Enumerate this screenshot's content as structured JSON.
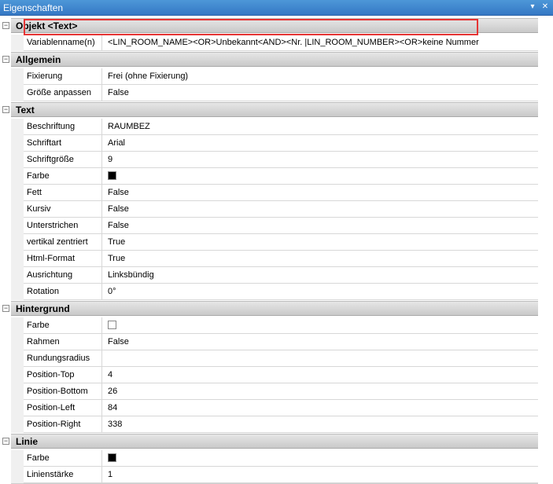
{
  "window": {
    "title": "Eigenschaften",
    "dropdown_glyph": "▾",
    "close_glyph": "✕"
  },
  "categories": [
    {
      "label": "Objekt <Text>",
      "rows": [
        {
          "name": "Variablenname(n)",
          "value": "<LIN_ROOM_NAME><OR>Unbekannt<AND><Nr. |LIN_ROOM_NUMBER><OR>keine Nummer"
        }
      ]
    },
    {
      "label": "Allgemein",
      "rows": [
        {
          "name": "Fixierung",
          "value": "Frei (ohne Fixierung)"
        },
        {
          "name": "Größe anpassen",
          "value": "False"
        }
      ]
    },
    {
      "label": "Text",
      "rows": [
        {
          "name": "Beschriftung",
          "value": "RAUMBEZ"
        },
        {
          "name": "Schriftart",
          "value": "Arial"
        },
        {
          "name": "Schriftgröße",
          "value": "9"
        },
        {
          "name": "Farbe",
          "value": "",
          "swatch": "#000000"
        },
        {
          "name": "Fett",
          "value": "False"
        },
        {
          "name": "Kursiv",
          "value": "False"
        },
        {
          "name": "Unterstrichen",
          "value": "False"
        },
        {
          "name": "vertikal zentriert",
          "value": "True"
        },
        {
          "name": "Html-Format",
          "value": "True"
        },
        {
          "name": "Ausrichtung",
          "value": "Linksbündig"
        },
        {
          "name": "Rotation",
          "value": "0°"
        }
      ]
    },
    {
      "label": "Hintergrund",
      "rows": [
        {
          "name": "Farbe",
          "value": "",
          "swatch": "#ffffff"
        },
        {
          "name": "Rahmen",
          "value": "False"
        },
        {
          "name": "Rundungsradius",
          "value": ""
        },
        {
          "name": "Position-Top",
          "value": "4"
        },
        {
          "name": "Position-Bottom",
          "value": "26"
        },
        {
          "name": "Position-Left",
          "value": "84"
        },
        {
          "name": "Position-Right",
          "value": "338"
        }
      ]
    },
    {
      "label": "Linie",
      "rows": [
        {
          "name": "Farbe",
          "value": "",
          "swatch": "#000000"
        },
        {
          "name": "Linienstärke",
          "value": "1"
        }
      ]
    }
  ],
  "colors": {
    "titlebar": "#3a82cc",
    "highlight": "#e53535",
    "category_bg": "#d4d4d4"
  }
}
